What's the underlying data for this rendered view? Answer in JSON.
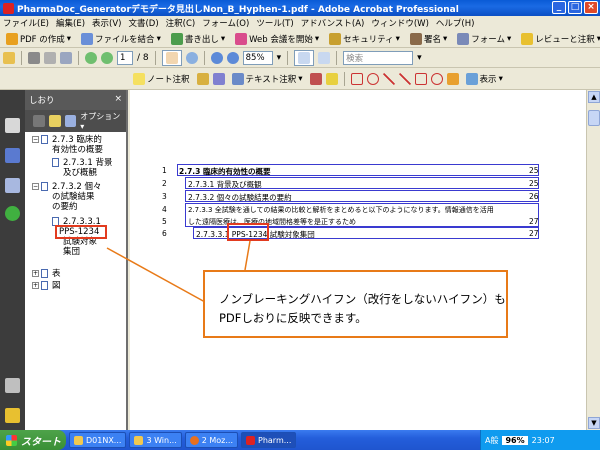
{
  "window": {
    "title": "PharmaDoc_Generatorデモデータ見出しNon_B_Hyphen-1.pdf - Adobe Acrobat Professional",
    "btn_min": "_",
    "btn_max": "□",
    "btn_close": "×"
  },
  "menu": [
    "ファイル(E)",
    "編集(E)",
    "表示(V)",
    "文書(D)",
    "注釈(C)",
    "フォーム(O)",
    "ツール(T)",
    "アドバンスト(A)",
    "ウィンドウ(W)",
    "ヘルプ(H)"
  ],
  "toolbar1": {
    "pdf_create": "PDF の作成",
    "combine": "ファイルを結合",
    "export": "書き出し",
    "web_meeting": "Web 会議を開始",
    "security": "セキュリティ",
    "sign": "署名",
    "forms": "フォーム",
    "review": "レビューと注釈"
  },
  "toolbar2": {
    "page_current": "1",
    "page_total": "/ 8",
    "zoom": "85%",
    "search_placeholder": "検索"
  },
  "toolbar3": {
    "note": "ノート注釈",
    "text_edit": "テキスト注釈",
    "show": "表示"
  },
  "bookmarks": {
    "header": "しおり",
    "options": "オプション",
    "items": {
      "i1_line1": "2.7.3  臨床的",
      "i1_line2": "有効性の概要",
      "i2_line1": "2.7.3.1  背景",
      "i2_line2": "及び概観",
      "i3_line1": "2.7.3.2  個々",
      "i3_line2": "の試験結果",
      "i3_line3": "の要約",
      "i4_line1": "2.7.3.3.1",
      "i4_code": "PPS-1234",
      "i4_line3": "試験対象",
      "i4_line4": "集団",
      "i5": "表",
      "i6": "図"
    }
  },
  "document": {
    "lines": [
      {
        "num": "1",
        "text": "2.7.3  臨床的有効性の概要",
        "page": "25"
      },
      {
        "num": "2",
        "text": "2.7.3.1  背景及び概観",
        "page": "25"
      },
      {
        "num": "3",
        "text": "2.7.3.2  個々の試験結果の要約",
        "page": "26"
      },
      {
        "num": "4",
        "text": "2.7.3.3  全試験を通しての結果の比較と解析をまとめると以下のようになります。情報通信を活用",
        "page": ""
      },
      {
        "num": "5",
        "text": "した遠隔医療は、医療の地域間格差等を是正するため",
        "page": "27"
      },
      {
        "num": "6",
        "text": "2.7.3.3.1  PPS-1234 試験対象集団",
        "page": "27"
      }
    ]
  },
  "callout": {
    "line1": "ノンブレーキングハイフン（改行をしないハイフン）も",
    "line2": "PDFしおりに反映できます。"
  },
  "taskbar": {
    "start": "スタート",
    "tasks": [
      "D01NX...",
      "3 Win...",
      "2 Moz...",
      "Pharm..."
    ],
    "ime": "A般",
    "battery": "96%",
    "clock": "23:07"
  },
  "colors": {
    "annotation": "#e23b1f",
    "callout_border": "#e87a18",
    "toc_box": "#3a3ad0"
  }
}
